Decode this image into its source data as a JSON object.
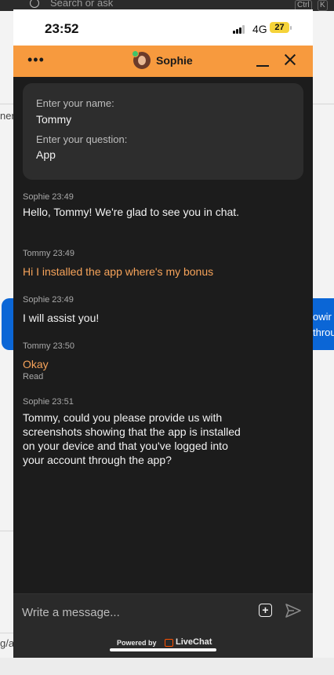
{
  "background": {
    "search_placeholder": "Search or ask",
    "ctrl_key": "Ctrl",
    "k_key": "K",
    "left_fragment": "ner",
    "right_fragment_1": "owir",
    "right_fragment_2": "throu",
    "bottom_fragment": "g/a"
  },
  "status_bar": {
    "time": "23:52",
    "network": "4G",
    "battery": "27"
  },
  "chat_header": {
    "agent_name": "Sophie",
    "menu_icon": "more-dots-icon",
    "minimize_icon": "minimize-icon",
    "close_icon": "close-icon"
  },
  "prechat_form": {
    "name_label": "Enter your name:",
    "name_value": "Tommy",
    "question_label": "Enter your question:",
    "question_value": "App"
  },
  "messages": [
    {
      "author": "Sophie",
      "time": "23:49",
      "meta": "Sophie 23:49",
      "text": "Hello, Tommy! We're glad to see you in chat."
    },
    {
      "author": "Tommy",
      "time": "23:49",
      "meta": "Tommy 23:49",
      "text": "Hi I installed the app where's my bonus"
    },
    {
      "author": "Sophie",
      "time": "23:49",
      "meta": "Sophie 23:49",
      "text": "I will assist you!"
    },
    {
      "author": "Tommy",
      "time": "23:50",
      "meta": "Tommy 23:50",
      "text": "Okay",
      "status": "Read"
    },
    {
      "author": "Sophie",
      "time": "23:51",
      "meta": "Sophie 23:51",
      "text": "Tommy, could you please provide us with screenshots showing that the app is installed on your device and that you've logged into your account through the app?"
    }
  ],
  "composer": {
    "placeholder": "Write a message...",
    "attach_icon": "plus-square-icon",
    "send_icon": "send-icon"
  },
  "footer": {
    "powered_by": "Powered by",
    "brand": "LiveChat"
  },
  "colors": {
    "header": "#f79a3e",
    "chat_bg": "#1c1c1c",
    "customer_text": "#f6a35a"
  }
}
